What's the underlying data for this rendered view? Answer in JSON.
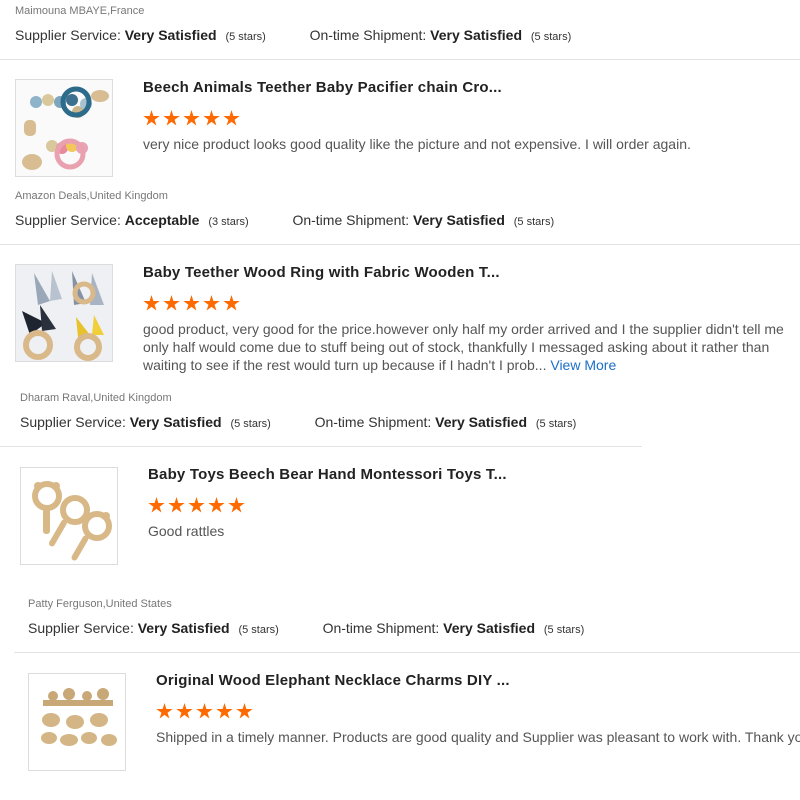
{
  "top": {
    "reviewer": "Maimouna MBAYE,France",
    "supplier_label": "Supplier Service:",
    "supplier_value": "Very Satisfied",
    "supplier_stars": "(5 stars)",
    "shipment_label": "On-time Shipment:",
    "shipment_value": "Very Satisfied",
    "shipment_stars": "(5 stars)"
  },
  "reviews": [
    {
      "title": "Beech Animals Teether Baby Pacifier chain Cro...",
      "rating": 5,
      "comment": "very nice product looks good quality like the picture and not expensive. I will order again.",
      "reviewer": "Amazon Deals,United Kingdom",
      "supplier_label": "Supplier Service:",
      "supplier_value": "Acceptable",
      "supplier_stars": "(3 stars)",
      "shipment_label": "On-time Shipment:",
      "shipment_value": "Very Satisfied",
      "shipment_stars": "(5 stars)"
    },
    {
      "title": "Baby Teether Wood Ring with Fabric Wooden T...",
      "rating": 5,
      "comment": "good product, very good for the price.however only half my order arrived and I the supplier didn't tell me only half would come due to stuff being out of stock, thankfully I messaged asking about it rather than waiting to see if the rest would turn up because if I hadn't I prob...",
      "view_more": "View More",
      "reviewer": "Dharam Raval,United Kingdom",
      "supplier_label": "Supplier Service:",
      "supplier_value": "Very Satisfied",
      "supplier_stars": "(5 stars)",
      "shipment_label": "On-time Shipment:",
      "shipment_value": "Very Satisfied",
      "shipment_stars": "(5 stars)"
    },
    {
      "title": "Baby Toys Beech Bear Hand Montessori Toys T...",
      "rating": 5,
      "comment": "Good rattles",
      "reviewer": "Patty Ferguson,United States",
      "supplier_label": "Supplier Service:",
      "supplier_value": "Very Satisfied",
      "supplier_stars": "(5 stars)",
      "shipment_label": "On-time Shipment:",
      "shipment_value": "Very Satisfied",
      "shipment_stars": "(5 stars)"
    },
    {
      "title": "Original Wood Elephant Necklace Charms DIY ...",
      "rating": 5,
      "comment": "Shipped in a timely manner.  Products are good quality and Supplier was pleasant to work with.  Thank you!"
    }
  ],
  "colors": {
    "star": "#ff6a00",
    "link": "#1a6fc9",
    "divider": "#e3e3e3"
  },
  "icons": {
    "rating_star": "star-icon",
    "product_image": "product-thumbnail"
  }
}
